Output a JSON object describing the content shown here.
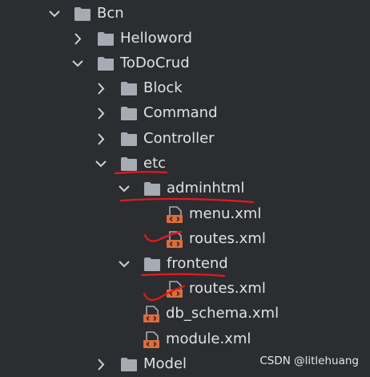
{
  "tree": {
    "nodes": [
      {
        "label": "Bcn",
        "kind": "folder",
        "expanded": true
      },
      {
        "label": "Helloword",
        "kind": "folder",
        "expanded": false
      },
      {
        "label": "ToDoCrud",
        "kind": "folder",
        "expanded": true
      },
      {
        "label": "Block",
        "kind": "folder",
        "expanded": false
      },
      {
        "label": "Command",
        "kind": "folder",
        "expanded": false
      },
      {
        "label": "Controller",
        "kind": "folder",
        "expanded": false
      },
      {
        "label": "etc",
        "kind": "folder",
        "expanded": true
      },
      {
        "label": "adminhtml",
        "kind": "folder",
        "expanded": true
      },
      {
        "label": "menu.xml",
        "kind": "xml-file"
      },
      {
        "label": "routes.xml",
        "kind": "xml-file"
      },
      {
        "label": "frontend",
        "kind": "folder",
        "expanded": true
      },
      {
        "label": "routes.xml",
        "kind": "xml-file"
      },
      {
        "label": "db_schema.xml",
        "kind": "xml-file"
      },
      {
        "label": "module.xml",
        "kind": "xml-file"
      },
      {
        "label": "Model",
        "kind": "folder",
        "expanded": false
      }
    ]
  },
  "watermark": "CSDN @litlehuang",
  "colors": {
    "background": "#2b2d30",
    "text": "#dfe1e5",
    "folder": "#a7abb3",
    "chevron": "#cfd1d5",
    "xml_file": "#e06c3c",
    "annotation": "#e8191d"
  }
}
